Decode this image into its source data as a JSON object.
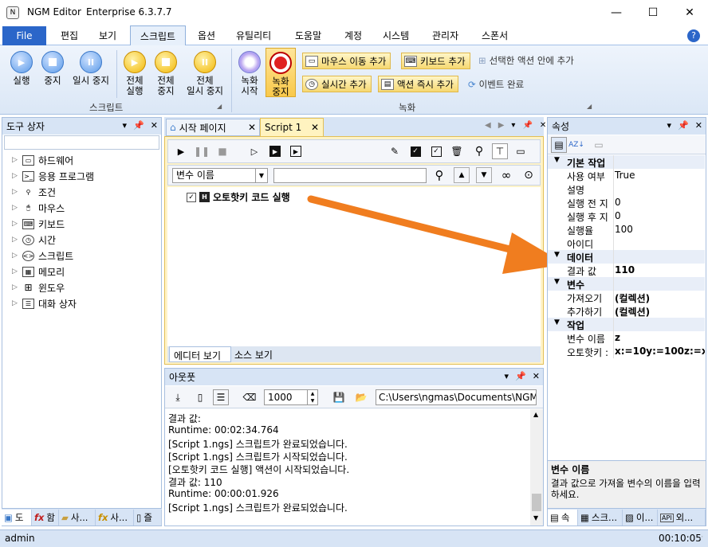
{
  "window": {
    "app_name": "NGM Editor",
    "edition": "Enterprise 6.3.7.7",
    "minimize": "—",
    "maximize": "☐",
    "close": "✕"
  },
  "menu": {
    "file": "File",
    "items": [
      "편집",
      "보기",
      "스크립트",
      "옵션",
      "유틸리티",
      "도움말",
      "계정",
      "시스템",
      "관리자",
      "스폰서"
    ],
    "help_icon": "?"
  },
  "ribbon": {
    "script_group": {
      "label": "스크립트",
      "buttons": [
        {
          "label": "실행"
        },
        {
          "label": "중지"
        },
        {
          "label": "일시 중지"
        },
        {
          "label": "전체\n실행"
        },
        {
          "label": "전체\n중지"
        },
        {
          "label": "전체\n일시 중지"
        }
      ]
    },
    "record_group": {
      "label": "녹화",
      "record_start": "녹화\n시작",
      "record_stop": "녹화\n중지",
      "mouse_move": "마우스 이동 추가",
      "keyboard": "키보드 추가",
      "add_in_selected": "선택한 액션 안에 추가",
      "realtime": "실시간 추가",
      "action_run": "액션 즉시 추가",
      "event_done": "이벤트 완료"
    }
  },
  "toolbox": {
    "title": "도구 상자",
    "items": [
      "하드웨어",
      "응용 프로그램",
      "조건",
      "마우스",
      "키보드",
      "시간",
      "스크립트",
      "메모리",
      "윈도우",
      "대화 상자"
    ],
    "tabs": [
      "도",
      "함",
      "사...",
      "사...",
      "즐"
    ]
  },
  "editor": {
    "tabs": [
      "시작 페이지",
      "Script 1"
    ],
    "var_select": "변수 이름",
    "action": "오토핫키 코드 실행",
    "bottom_tabs": [
      "에디터 보기",
      "소스 보기"
    ]
  },
  "output": {
    "title": "아웃풋",
    "count": "1000",
    "path": "C:\\Users\\ngmas\\Documents\\NGM6\\",
    "lines": [
      "결과 값:",
      "Runtime: 00:02:34.764",
      "[Script 1.ngs] 스크립트가 완료되었습니다.",
      "[Script 1.ngs] 스크립트가 시작되었습니다.",
      "[오토핫키 코드 실행] 액션이 시작되었습니다.",
      "결과 값: 110",
      "Runtime: 00:00:01.926",
      "[Script 1.ngs] 스크립트가 완료되었습니다."
    ]
  },
  "properties": {
    "title": "속성",
    "sections": [
      {
        "name": "기본 작업",
        "rows": [
          [
            "사용 여부",
            "True"
          ],
          [
            "설명",
            ""
          ],
          [
            "실행 전 지",
            "0"
          ],
          [
            "실행 후 지",
            "0"
          ],
          [
            "실행율",
            "100"
          ],
          [
            "아이디",
            ""
          ]
        ]
      },
      {
        "name": "데이터",
        "rows": [
          [
            "결과 값",
            "110"
          ]
        ]
      },
      {
        "name": "변수",
        "rows": [
          [
            "가져오기",
            "(컬렉션)"
          ],
          [
            "추가하기",
            "(컬렉션)"
          ]
        ]
      },
      {
        "name": "작업",
        "rows": [
          [
            "변수 이름",
            "z"
          ],
          [
            "오토핫키 :",
            "x:=10y:=100z:=x+y"
          ]
        ]
      }
    ],
    "help_title": "변수 이름",
    "help_text": "결과 값으로 가져올 변수의 이름을 입력하세요.",
    "tabs": [
      "속",
      "스크...",
      "이...",
      "외..."
    ]
  },
  "status": {
    "user": "admin",
    "time": "00:10:05"
  },
  "colors": {
    "accent": "#2b66c9",
    "arrow": "#f07d1f"
  }
}
